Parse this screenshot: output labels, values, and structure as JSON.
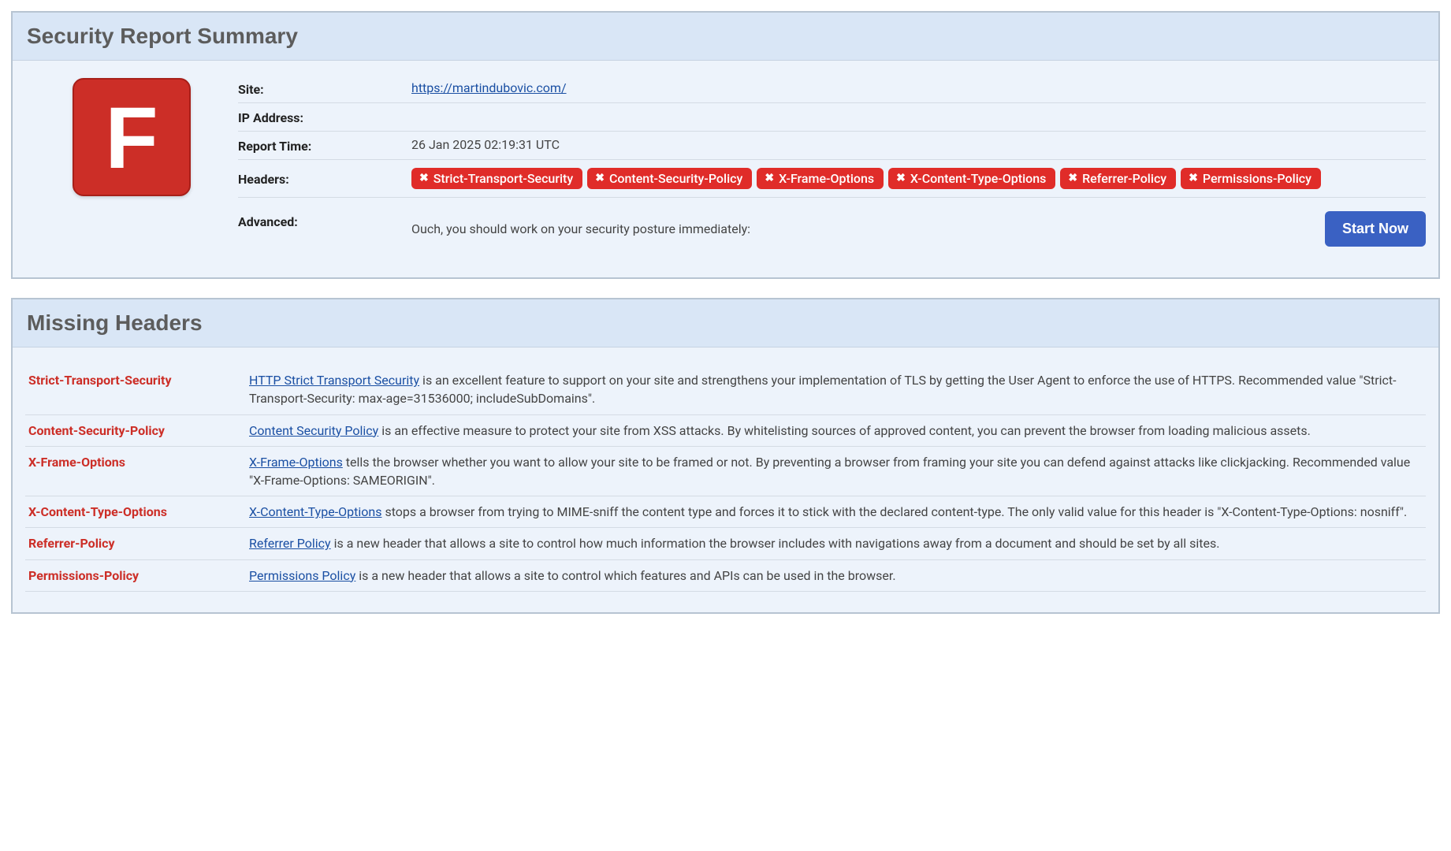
{
  "summary": {
    "panel_title": "Security Report Summary",
    "grade": "F",
    "rows": {
      "site_label": "Site:",
      "site_url": "https://martindubovic.com/",
      "ip_label": "IP Address:",
      "ip_value": "",
      "time_label": "Report Time:",
      "time_value": "26 Jan 2025 02:19:31 UTC",
      "headers_label": "Headers:",
      "advanced_label": "Advanced:",
      "advanced_text": "Ouch, you should work on your security posture immediately:",
      "start_now": "Start Now"
    },
    "header_badges": [
      "Strict-Transport-Security",
      "Content-Security-Policy",
      "X-Frame-Options",
      "X-Content-Type-Options",
      "Referrer-Policy",
      "Permissions-Policy"
    ]
  },
  "missing": {
    "panel_title": "Missing Headers",
    "rows": [
      {
        "name": "Strict-Transport-Security",
        "link_text": "HTTP Strict Transport Security",
        "desc_tail": " is an excellent feature to support on your site and strengthens your implementation of TLS by getting the User Agent to enforce the use of HTTPS. Recommended value \"Strict-Transport-Security: max-age=31536000; includeSubDomains\"."
      },
      {
        "name": "Content-Security-Policy",
        "link_text": "Content Security Policy",
        "desc_tail": " is an effective measure to protect your site from XSS attacks. By whitelisting sources of approved content, you can prevent the browser from loading malicious assets."
      },
      {
        "name": "X-Frame-Options",
        "link_text": "X-Frame-Options",
        "desc_tail": " tells the browser whether you want to allow your site to be framed or not. By preventing a browser from framing your site you can defend against attacks like clickjacking. Recommended value \"X-Frame-Options: SAMEORIGIN\"."
      },
      {
        "name": "X-Content-Type-Options",
        "link_text": "X-Content-Type-Options",
        "desc_tail": " stops a browser from trying to MIME-sniff the content type and forces it to stick with the declared content-type. The only valid value for this header is \"X-Content-Type-Options: nosniff\"."
      },
      {
        "name": "Referrer-Policy",
        "link_text": "Referrer Policy",
        "desc_tail": " is a new header that allows a site to control how much information the browser includes with navigations away from a document and should be set by all sites."
      },
      {
        "name": "Permissions-Policy",
        "link_text": "Permissions Policy",
        "desc_tail": " is a new header that allows a site to control which features and APIs can be used in the browser."
      }
    ]
  }
}
